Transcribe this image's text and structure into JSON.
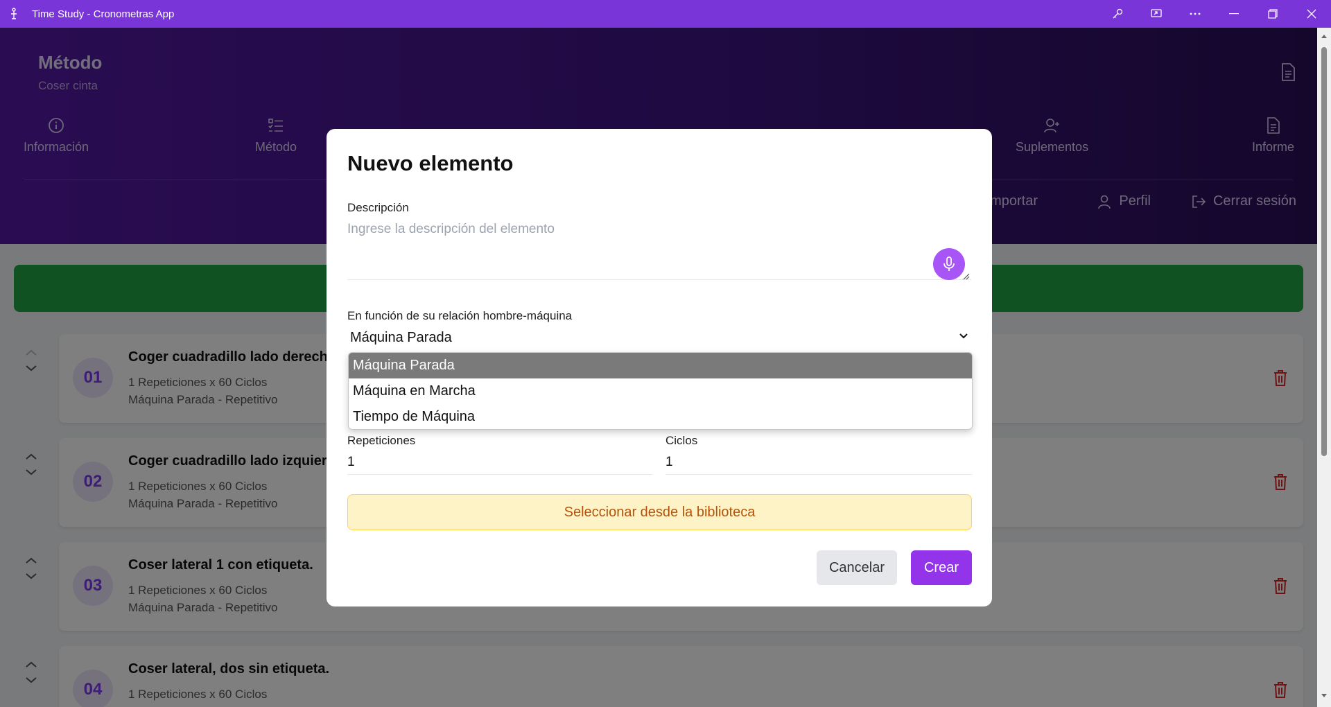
{
  "window": {
    "title": "Time Study - Cronometras App"
  },
  "header": {
    "title": "Método",
    "subtitle": "Coser cinta",
    "nav": [
      {
        "label": "Información",
        "icon": "info-icon"
      },
      {
        "label": "Método",
        "icon": "list-check-icon"
      },
      {
        "label": "Suplementos",
        "icon": "user-plus-icon"
      },
      {
        "label": "Informe",
        "icon": "document-icon"
      }
    ],
    "actions": [
      {
        "label": "Importar"
      },
      {
        "label": "Perfil",
        "icon": "user-icon"
      },
      {
        "label": "Cerrar sesión",
        "icon": "logout-icon"
      }
    ]
  },
  "elements": [
    {
      "number": "01",
      "name": "Coger cuadradillo lado derecho",
      "line1": "1 Repeticiones x 60 Ciclos",
      "line2": "Máquina Parada - Repetitivo"
    },
    {
      "number": "02",
      "name": "Coger cuadradillo lado izquierd",
      "line1": "1 Repeticiones x 60 Ciclos",
      "line2": "Máquina Parada - Repetitivo"
    },
    {
      "number": "03",
      "name": "Coser lateral 1 con etiqueta.",
      "line1": "1 Repeticiones x 60 Ciclos",
      "line2": "Máquina Parada - Repetitivo"
    },
    {
      "number": "04",
      "name": "Coser lateral, dos sin etiqueta.",
      "line1": "1 Repeticiones x 60 Ciclos",
      "line2": ""
    }
  ],
  "modal": {
    "title": "Nuevo elemento",
    "description_label": "Descripción",
    "description_placeholder": "Ingrese la descripción del elemento",
    "relation_label": "En función de su relación hombre-máquina",
    "relation_selected": "Máquina Parada",
    "relation_options": [
      "Máquina Parada",
      "Máquina en Marcha",
      "Tiempo de Máquina"
    ],
    "repetitions_label": "Repeticiones",
    "repetitions_value": "1",
    "cycles_label": "Ciclos",
    "cycles_value": "1",
    "library_button": "Seleccionar desde la biblioteca",
    "cancel_button": "Cancelar",
    "create_button": "Crear"
  },
  "colors": {
    "titlebar": "#7a35d8",
    "accent": "#9333ea",
    "banner": "#22a447",
    "danger": "#dc2626"
  }
}
